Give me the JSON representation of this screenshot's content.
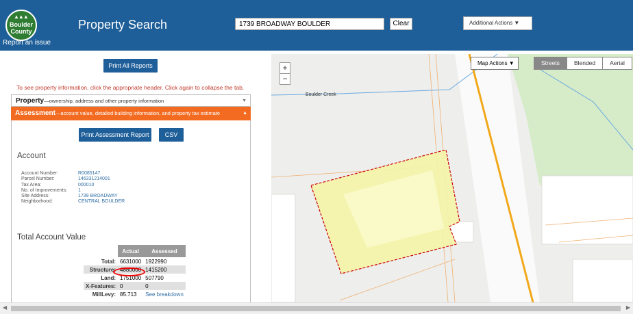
{
  "header": {
    "logo_text": "Boulder County",
    "report_link": "Report an issue",
    "title": "Property Search",
    "search_value": "1739 BROADWAY BOULDER",
    "clear_label": "Clear",
    "additional_actions": "Additional Actions ▼"
  },
  "left": {
    "print_all": "Print All Reports",
    "hint": "To see property information, click the appropriate header. Click again to collapse the tab.",
    "property_tab": {
      "title": "Property",
      "desc": "—ownership, address and other property information",
      "caret": "▼"
    },
    "assessment_tab": {
      "title": "Assessment",
      "desc": "—account value, detailed building information, and property tax estimate",
      "caret": "▲"
    },
    "print_assessment": "Print Assessment Report",
    "csv": "CSV",
    "account_title": "Account",
    "account": {
      "labels": [
        "Account Number:",
        "Parcel Number:",
        "Tax Area:",
        "No. of Improvements:",
        "Site Address:",
        "Neighborhood:"
      ],
      "values": [
        "R0085147",
        "146331214001",
        "000010",
        "1",
        "1739 BROADWAY",
        "CENTRAL BOULDER"
      ]
    },
    "total_value_title": "Total Account Value",
    "value_table": {
      "headers": [
        "Actual",
        "Assessed"
      ],
      "rows": [
        {
          "label": "Total:",
          "actual": "6631000",
          "assessed": "1922990"
        },
        {
          "label": "Structure:",
          "actual": "4880000",
          "assessed": "1415200"
        },
        {
          "label": "Land:",
          "actual": "1751000",
          "assessed": "507790"
        },
        {
          "label": "X-Features:",
          "actual": "0",
          "assessed": "0"
        },
        {
          "label": "MillLevy:",
          "actual": "85.713",
          "assessed": "See breakdown"
        }
      ]
    }
  },
  "map": {
    "zoom_in": "+",
    "zoom_out": "−",
    "map_actions": "Map Actions ▼",
    "basemaps": [
      "Streets",
      "Blended",
      "Aerial"
    ],
    "creek_label": "Boulder Creek"
  },
  "scrollbar": {
    "left_arrow": "◀",
    "right_arrow": "▶"
  }
}
